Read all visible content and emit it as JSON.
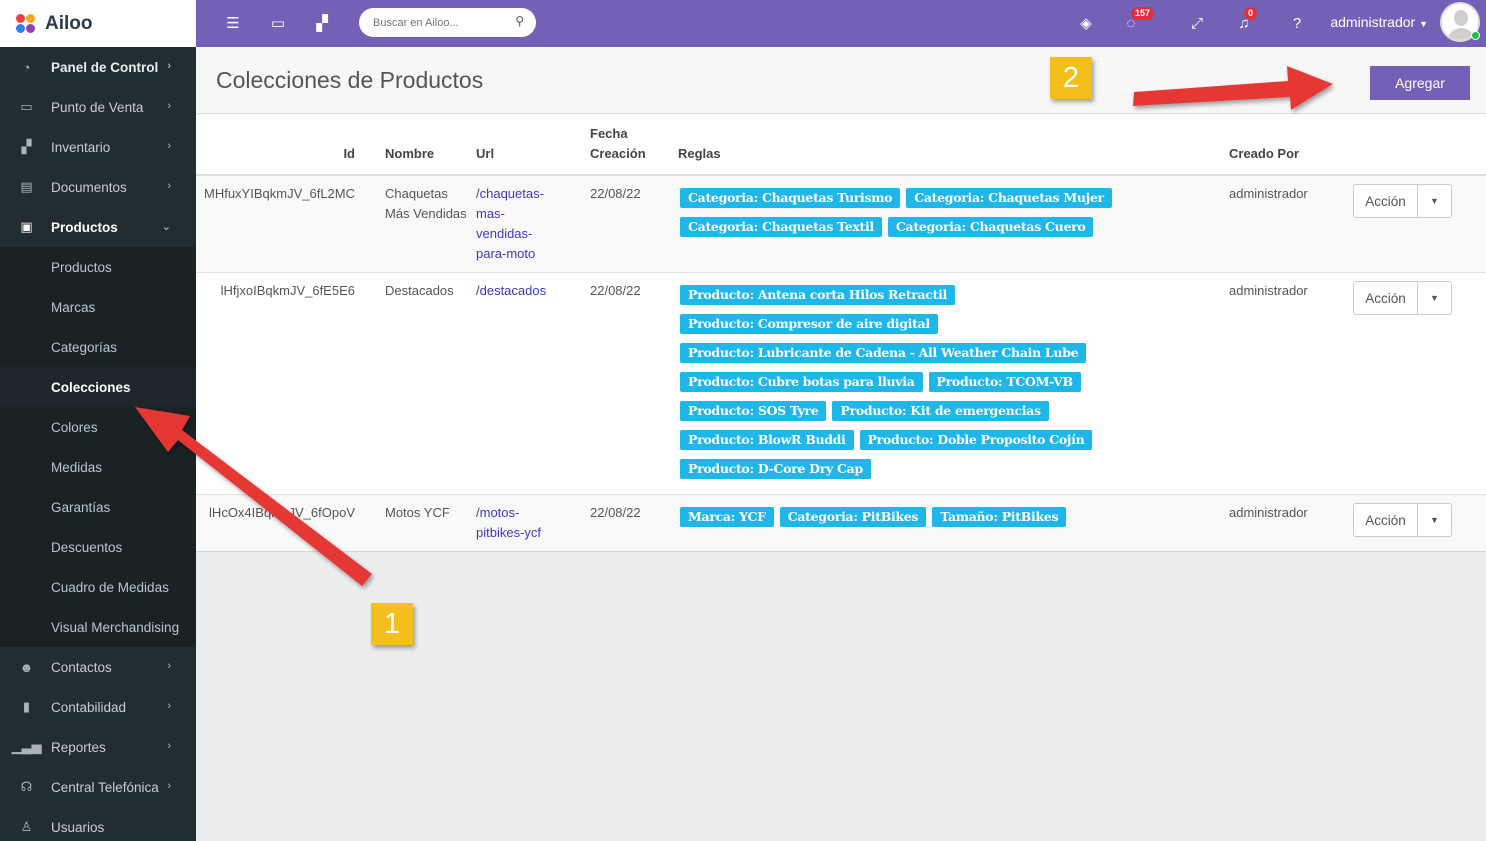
{
  "app": {
    "name": "Ailoo"
  },
  "sidebar": {
    "items": [
      {
        "label": "Panel de Control",
        "icon": "dashboard-icon",
        "bold": true
      },
      {
        "label": "Punto de Venta",
        "icon": "monitor-icon"
      },
      {
        "label": "Inventario",
        "icon": "boxes-icon"
      },
      {
        "label": "Documentos",
        "icon": "document-icon"
      },
      {
        "label": "Productos",
        "icon": "gift-icon",
        "open": true
      }
    ],
    "submenu": [
      "Productos",
      "Marcas",
      "Categorías",
      "Colecciones",
      "Colores",
      "Medidas",
      "Garantías",
      "Descuentos",
      "Cuadro de Medidas",
      "Visual Merchandising"
    ],
    "submenu_active": "Colecciones",
    "items_after": [
      {
        "label": "Contactos",
        "icon": "users-icon"
      },
      {
        "label": "Contabilidad",
        "icon": "book-icon"
      },
      {
        "label": "Reportes",
        "icon": "bar-chart-icon"
      },
      {
        "label": "Central Telefónica",
        "icon": "headset-icon"
      },
      {
        "label": "Usuarios",
        "icon": "user-icon"
      }
    ]
  },
  "topbar": {
    "search_placeholder": "Buscar en Ailoo...",
    "whatsapp_badge": "157",
    "notifications_badge": "0",
    "user": "administrador"
  },
  "page": {
    "title": "Colecciones de Productos",
    "add_label": "Agregar"
  },
  "table": {
    "headers": {
      "id": "Id",
      "name": "Nombre",
      "url": "Url",
      "date": "Fecha Creación",
      "rules": "Reglas",
      "created_by": "Creado Por"
    },
    "rows": [
      {
        "id": "MHfuxYIBqkmJV_6fL2MC",
        "name": "Chaquetas Más Vendidas",
        "url": "/chaquetas-mas-vendidas-para-moto",
        "date": "22/08/22",
        "rules": [
          "Categoria: Chaquetas Turismo",
          "Categoria: Chaquetas Mujer",
          "Categoria: Chaquetas Textil",
          "Categoria: Chaquetas Cuero"
        ],
        "created_by": "administrador",
        "action": "Acción"
      },
      {
        "id": "lHfjxoIBqkmJV_6fE5E6",
        "name": "Destacados",
        "url": "/destacados",
        "date": "22/08/22",
        "rules": [
          "Producto: Antena corta Hilos Retractil",
          "Producto: Compresor de aire digital",
          "Producto: Lubricante de Cadena - All Weather Chain Lube",
          "Producto: Cubre botas para lluvia",
          "Producto: TCOM-VB",
          "Producto: SOS Tyre",
          "Producto: Kit de emergencias",
          "Producto: BlowR Buddi",
          "Producto: Doble Proposito Cojín",
          "Producto: D-Core Dry Cap"
        ],
        "created_by": "administrador",
        "action": "Acción"
      },
      {
        "id": "lHcOx4IBqkmJV_6fOpoV",
        "name": "Motos YCF",
        "url": "/motos-pitbikes-ycf",
        "date": "22/08/22",
        "rules": [
          "Marca: YCF",
          "Categoria: PitBikes",
          "Tamaño: PitBikes"
        ],
        "created_by": "administrador",
        "action": "Acción"
      }
    ]
  },
  "annotations": {
    "marker_1": "1",
    "marker_2": "2"
  },
  "colors": {
    "accent": "#7560b8",
    "sidebar": "#222d32",
    "tag": "#1fb6e8",
    "arrow": "#e53935",
    "marker": "#f5bf1b"
  }
}
